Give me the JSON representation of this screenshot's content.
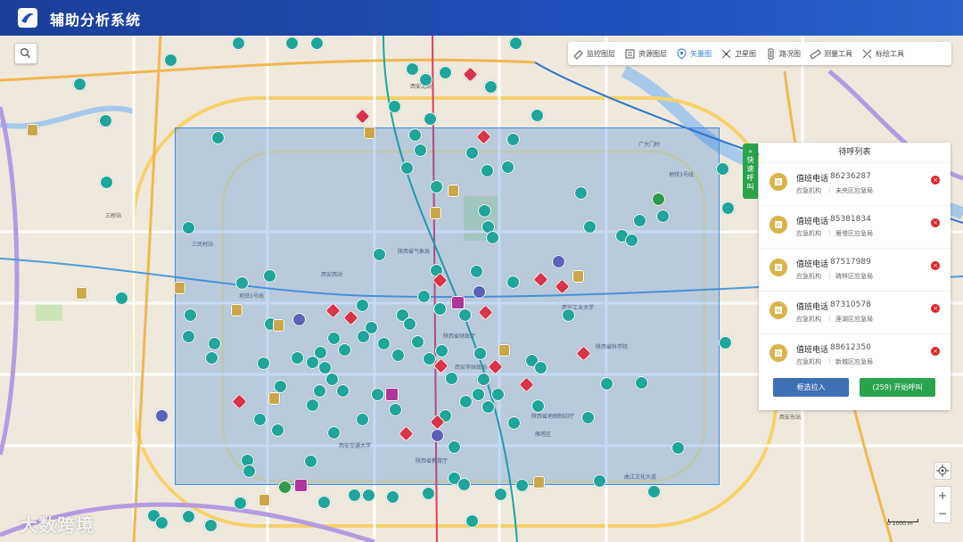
{
  "app": {
    "title": "辅助分析系统"
  },
  "toolbar": {
    "items": [
      {
        "label": "监控图层",
        "icon": "monitor-icon"
      },
      {
        "label": "资源图层",
        "icon": "resource-icon"
      },
      {
        "label": "矢量图",
        "icon": "vector-map-icon",
        "active": true
      },
      {
        "label": "卫星图",
        "icon": "satellite-icon"
      },
      {
        "label": "路况图",
        "icon": "traffic-icon"
      },
      {
        "label": "测量工具",
        "icon": "ruler-icon"
      },
      {
        "label": "标绘工具",
        "icon": "plot-tool-icon"
      }
    ]
  },
  "side_tab": {
    "label": "快速呼叫"
  },
  "call_panel": {
    "title": "待呼列表",
    "items": [
      {
        "name": "值班电话",
        "phone": "86236287",
        "org": "应急机构",
        "region": "未央区应急局"
      },
      {
        "name": "值班电话",
        "phone": "85381834",
        "org": "应急机构",
        "region": "雁塔区应急局"
      },
      {
        "name": "值班电话",
        "phone": "87517989",
        "org": "应急机构",
        "region": "碑林区应急局"
      },
      {
        "name": "值班电话",
        "phone": "87310578",
        "org": "应急机构",
        "region": "莲湖区应急局"
      },
      {
        "name": "值班电话",
        "phone": "88612350",
        "org": "应急机构",
        "region": "新城区应急局"
      }
    ],
    "pull_button": "框选拉入",
    "call_button": "(259) 开始呼叫"
  },
  "map": {
    "scale_text": "0      1000 m",
    "labels": [
      {
        "text": "西安北站"
      },
      {
        "text": "三桥站"
      },
      {
        "text": "西安西站"
      },
      {
        "text": "西安东站"
      },
      {
        "text": "地铁1号线"
      },
      {
        "text": "地铁3号线"
      },
      {
        "text": "三民村站"
      },
      {
        "text": "广大门村"
      },
      {
        "text": "陕西省气象局"
      },
      {
        "text": "陕西省财政厅"
      },
      {
        "text": "陕西省科学院"
      },
      {
        "text": "西安工业大学"
      },
      {
        "text": "陕西省教育厅"
      },
      {
        "text": "雁塔区"
      },
      {
        "text": "曲江文化大道"
      },
      {
        "text": "西安交通大学"
      },
      {
        "text": "陕西省地图制印厅"
      },
      {
        "text": "西安市财政局"
      }
    ]
  },
  "watermark": "大数跨境",
  "colors": {
    "header": "#1e4fb8",
    "accent": "#2aa34d",
    "selection": "#2e7ad6",
    "danger": "#e02424"
  }
}
